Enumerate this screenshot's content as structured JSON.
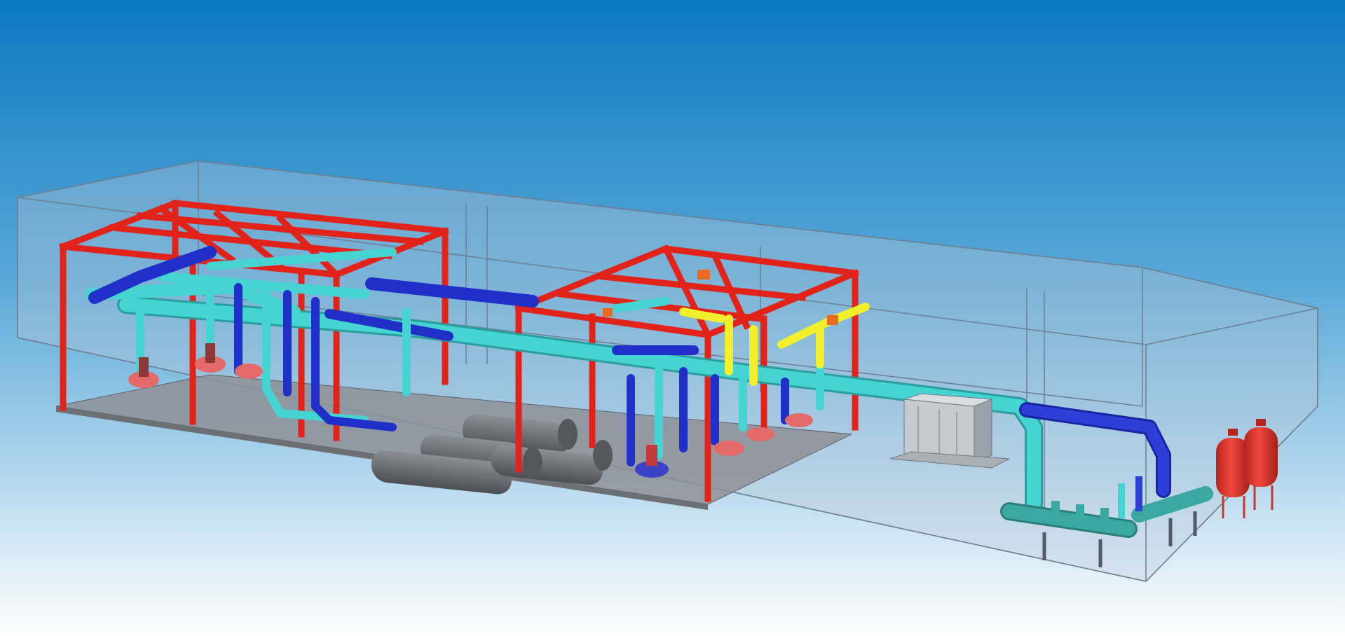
{
  "colors": {
    "sky_top": "#0a79c0",
    "sky_mid": "#5aa9d8",
    "sky_bottom": "#ffffff",
    "room_line": "#6f7f92",
    "room_fill": "#b8c6d3",
    "floor": "#8e9196",
    "frame_red": "#e2231a",
    "supply_cyan": "#45d4d2",
    "return_blue": "#1f2fc8",
    "condensate_yellow": "#f2ef2c",
    "chiller_gray": "#6d6f75",
    "tank_red": "#e0342b",
    "cabinet_gray": "#c4cbd0",
    "header_teal": "#3aa7a0",
    "steel_dark": "#505a66"
  },
  "icons": {
    "room": "equipment-room-enclosure",
    "frame": "steel-support-frame",
    "pump": "water-pump-icon",
    "chiller": "chiller-unit-icon",
    "valve": "valve-icon",
    "cabinet": "control-cabinet-icon",
    "tank": "expansion-tank-icon",
    "header": "water-header-manifold-icon"
  }
}
